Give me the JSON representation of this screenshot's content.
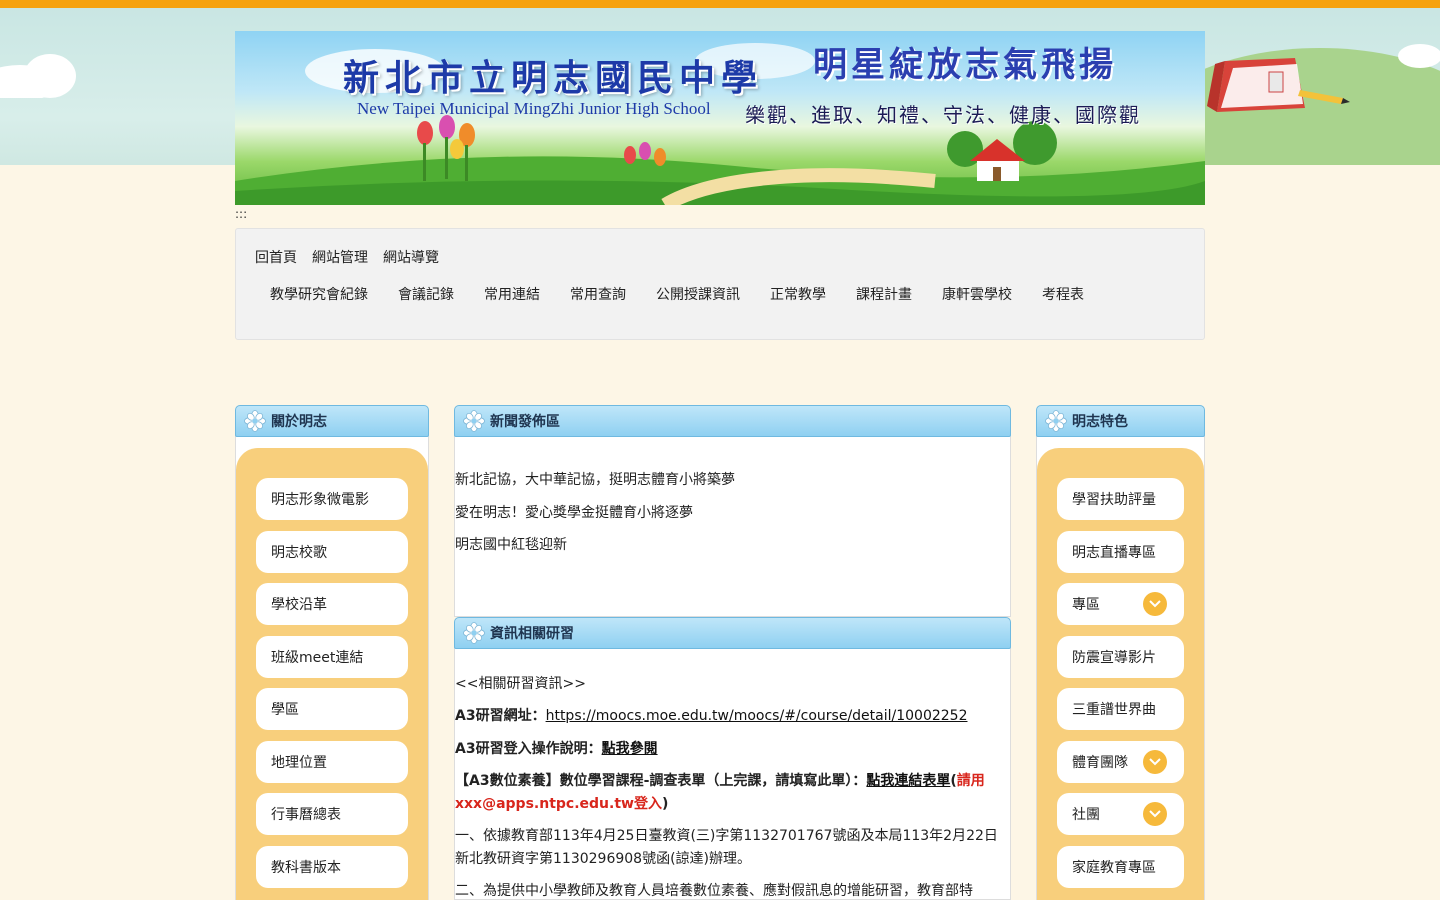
{
  "banner": {
    "school_name": "新北市立明志國民中學",
    "school_name_en": "New Taipei Municipal MingZhi Junior High School",
    "slogan": "明星綻放志氣飛揚",
    "virtues": "樂觀、進取、知禮、守法、健康、國際觀"
  },
  "skip_link": ":::",
  "nav": {
    "util": [
      "回首頁",
      "網站管理",
      "網站導覽"
    ],
    "main": [
      "教學研究會紀錄",
      "會議記錄",
      "常用連結",
      "常用查詢",
      "公開授課資訊",
      "正常教學",
      "課程計畫",
      "康軒雲學校",
      "考程表"
    ]
  },
  "left_panel": {
    "title": "關於明志",
    "items": [
      "明志形象微電影",
      "明志校歌",
      "學校沿革",
      "班級meet連結",
      "學區",
      "地理位置",
      "行事曆總表",
      "教科書版本"
    ]
  },
  "news_panel": {
    "title": "新聞發佈區",
    "items": [
      "新北記協，大中華記協，挺明志體育小將築夢",
      "愛在明志！愛心獎學金挺體育小將逐夢",
      "明志國中紅毯迎新"
    ]
  },
  "info_panel": {
    "title": "資訊相關研習",
    "intro": "<<相關研習資訊>>",
    "a3_label": "A3研習網址：",
    "a3_url": "https://moocs.moe.edu.tw/moocs/#/course/detail/10002252",
    "login_label": "A3研習登入操作說明：",
    "login_link": "點我參閱",
    "survey_prefix": "【A3數位素養】數位學習課程-調查表單（上完課，請填寫此單）：",
    "survey_link": "點我連結表單",
    "survey_paren_open": "(",
    "survey_note": "請用xxx@apps.ntpc.edu.tw登入",
    "survey_paren_close": ")",
    "para1": "一、依據教育部113年4月25日臺教資(三)字第1132701767號函及本局113年2月22日新北教研資字第1130296908號函(諒達)辦理。",
    "para2": "二、為提供中小學教師及教育人員培養數位素養、應對假訊息的增能研習，教育部特"
  },
  "right_panel": {
    "title": "明志特色",
    "items": [
      {
        "label": "學習扶助評量",
        "expandable": false
      },
      {
        "label": "明志直播專區",
        "expandable": false
      },
      {
        "label": "專區",
        "expandable": true
      },
      {
        "label": "防震宣導影片",
        "expandable": false
      },
      {
        "label": "三重譜世界曲",
        "expandable": false
      },
      {
        "label": "體育團隊",
        "expandable": true
      },
      {
        "label": "社團",
        "expandable": true
      },
      {
        "label": "家庭教育專區",
        "expandable": false
      }
    ]
  },
  "colors": {
    "top_stripe": "#f6a20e",
    "page_bg": "#fdf6e6",
    "panel_header": "#8fd0f1",
    "side_bg": "#f8cf7c",
    "chevron": "#f6b93b",
    "alert_red": "#d8261c"
  }
}
